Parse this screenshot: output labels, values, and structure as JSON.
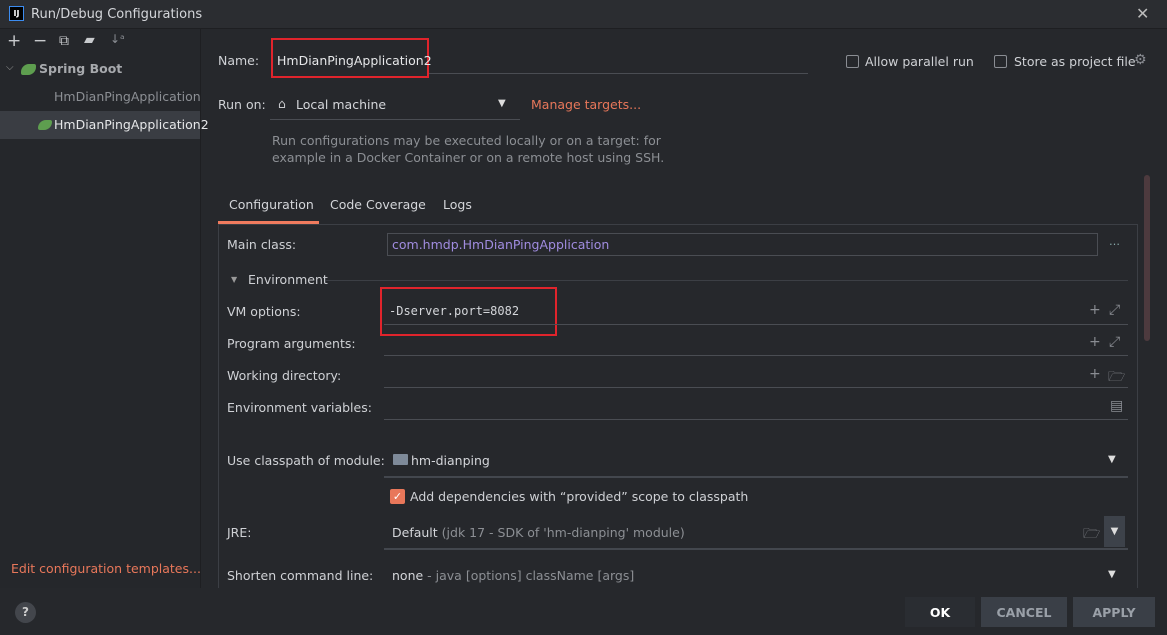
{
  "window": {
    "title": "Run/Debug Configurations",
    "app_icon": "IJ"
  },
  "sidebar": {
    "toolbar": [
      "add-icon",
      "remove-icon",
      "copy-icon",
      "new-folder-icon",
      "sort-icon"
    ],
    "group": "Spring Boot",
    "items": [
      {
        "label": "HmDianPingApplication",
        "selected": false
      },
      {
        "label": "HmDianPingApplication2",
        "selected": true
      }
    ],
    "edit_templates": "Edit configuration templates..."
  },
  "form": {
    "name_label": "Name:",
    "name_value": "HmDianPingApplication2",
    "allow_parallel": {
      "label": "Allow parallel run",
      "checked": false
    },
    "store_project": {
      "label": "Store as project file",
      "checked": false
    },
    "run_on_label": "Run on:",
    "run_on_value": "Local machine",
    "manage_targets": "Manage targets...",
    "run_on_desc1": "Run configurations may be executed locally or on a target: for",
    "run_on_desc2": "example in a Docker Container or on a remote host using SSH."
  },
  "tabs": [
    {
      "label": "Configuration",
      "active": true
    },
    {
      "label": "Code Coverage"
    },
    {
      "label": "Logs"
    }
  ],
  "config": {
    "main_class_label": "Main class:",
    "main_class_value": "com.hmdp.HmDianPingApplication",
    "environment": "Environment",
    "vm_label": "VM options:",
    "vm_value": "-Dserver.port=8082",
    "program_args_label": "Program arguments:",
    "working_dir_label": "Working directory:",
    "env_vars_label": "Environment variables:",
    "classpath_label": "Use classpath of module:",
    "classpath_value": "hm-dianping",
    "add_deps": {
      "label": "Add dependencies with “provided” scope to classpath",
      "checked": true
    },
    "jre_label": "JRE:",
    "jre_value": "Default",
    "jre_detail": "(jdk 17 - SDK of 'hm-dianping' module)",
    "shorten_label": "Shorten command line:",
    "shorten_value": "none",
    "shorten_detail": "- java [options] className [args]"
  },
  "footer": {
    "ok": "OK",
    "cancel": "CANCEL",
    "apply": "APPLY",
    "help": "?"
  },
  "colors": {
    "accent": "#e8775a",
    "highlight_box": "#e0242c",
    "main_class": "#a08ce0"
  }
}
